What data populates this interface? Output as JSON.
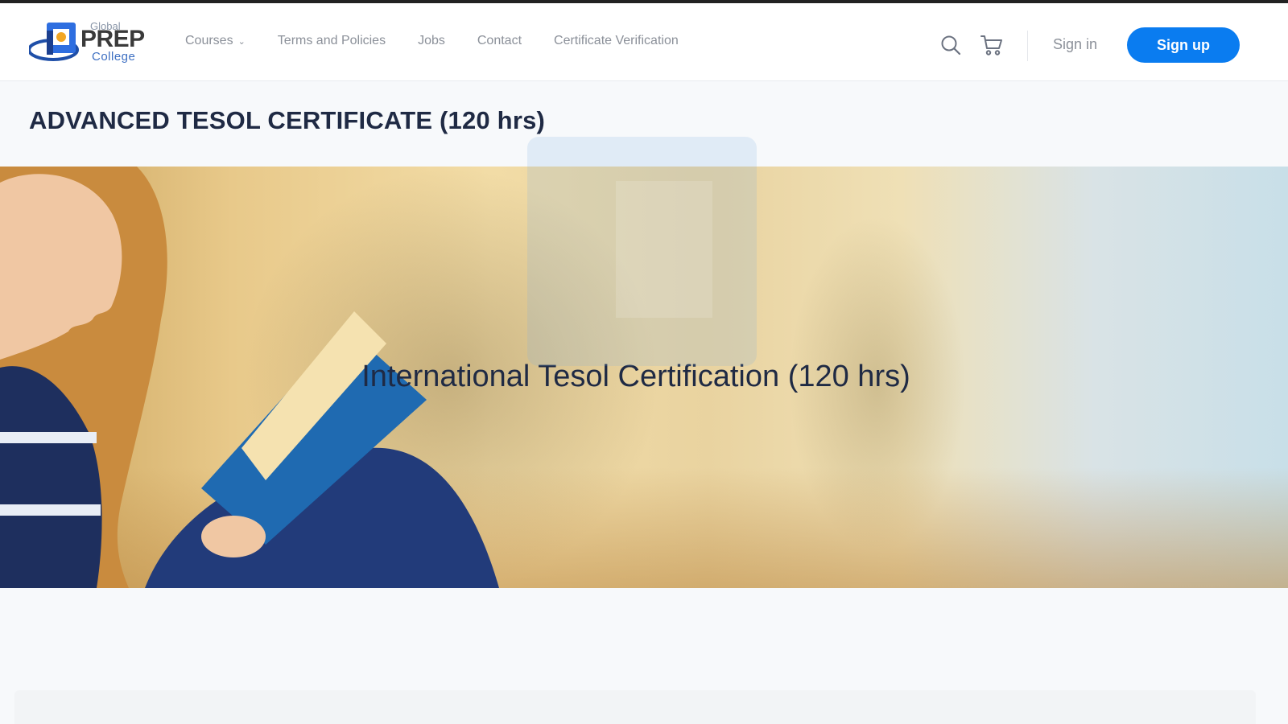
{
  "logo": {
    "brand": "PREP",
    "sup": "Global",
    "sub": "College"
  },
  "nav": {
    "items": [
      {
        "label": "Courses",
        "has_dropdown": true
      },
      {
        "label": "Terms and Policies"
      },
      {
        "label": "Jobs"
      },
      {
        "label": "Contact"
      },
      {
        "label": "Certificate Verification"
      }
    ]
  },
  "header": {
    "search_icon": "search-icon",
    "cart_icon": "cart-icon",
    "signin_label": "Sign in",
    "signup_label": "Sign up"
  },
  "colors": {
    "accent": "#0a7cf0",
    "title": "#1f2a44",
    "nav_text": "#8b9099"
  },
  "page": {
    "title": "ADVANCED TESOL CERTIFICATE (120 hrs)"
  },
  "hero": {
    "caption": "International Tesol Certification (120 hrs)"
  }
}
